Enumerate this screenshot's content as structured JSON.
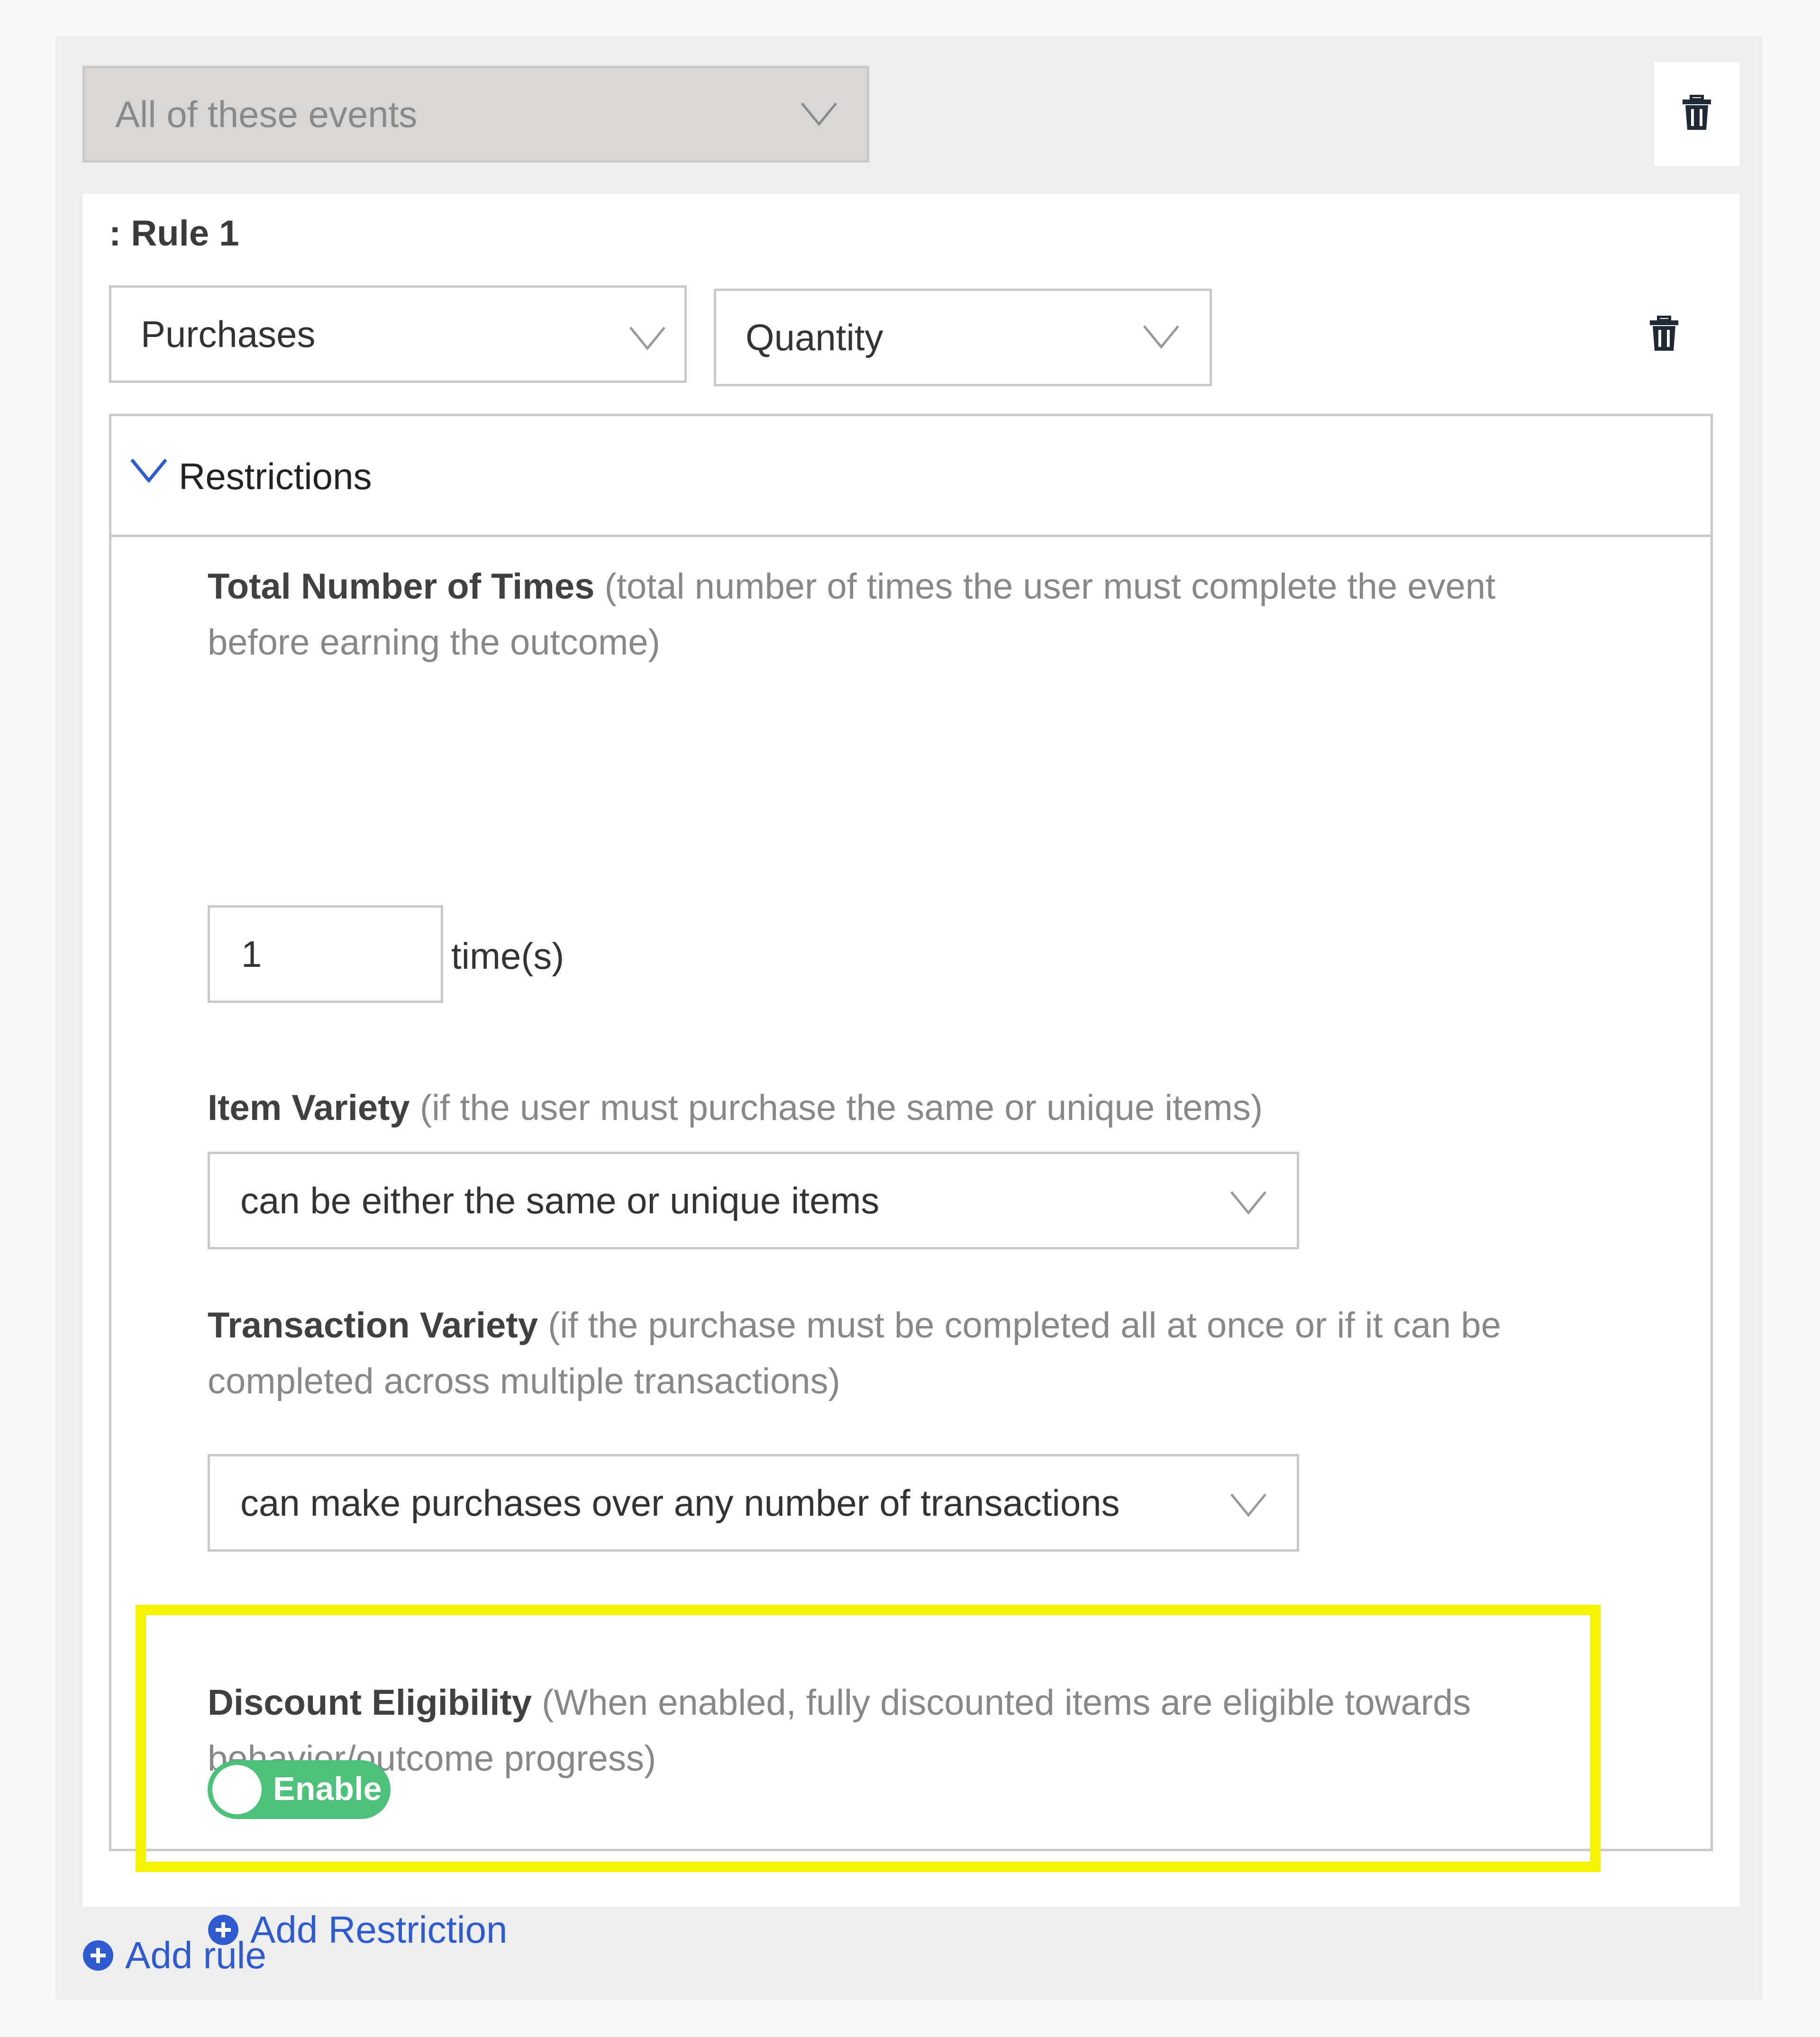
{
  "group": {
    "selected": "All of these events"
  },
  "rule": {
    "title": ": Rule 1",
    "event_select": "Purchases",
    "metric_select": "Quantity"
  },
  "restrictions": {
    "header": "Restrictions",
    "total_times": {
      "label": "Total Number of Times",
      "hint": "(total number of times the user must complete the event before earning the outcome)",
      "value": "1",
      "unit": "time(s)"
    },
    "item_variety": {
      "label": "Item Variety",
      "hint": "(if the user must purchase the same or unique items)",
      "selected": "can be either the same or unique items"
    },
    "transaction_variety": {
      "label": "Transaction Variety",
      "hint": "(if the purchase must be completed all at once or if it can be completed across multiple transactions)",
      "selected": "can make purchases over any number of transactions"
    },
    "discount_eligibility": {
      "label": "Discount Eligibility",
      "hint": "(When enabled, fully discounted items are eligible towards behavior/outcome progress)",
      "toggle_label": "Enable"
    },
    "add_restriction": "Add Restriction"
  },
  "add_rule": "Add rule",
  "colors": {
    "accent_blue": "#2f5bd0",
    "toggle_green": "#4bc17a",
    "highlight_yellow": "#f4f200"
  },
  "icons": [
    "trash-icon",
    "chevron-down-icon",
    "plus-circle-icon"
  ]
}
